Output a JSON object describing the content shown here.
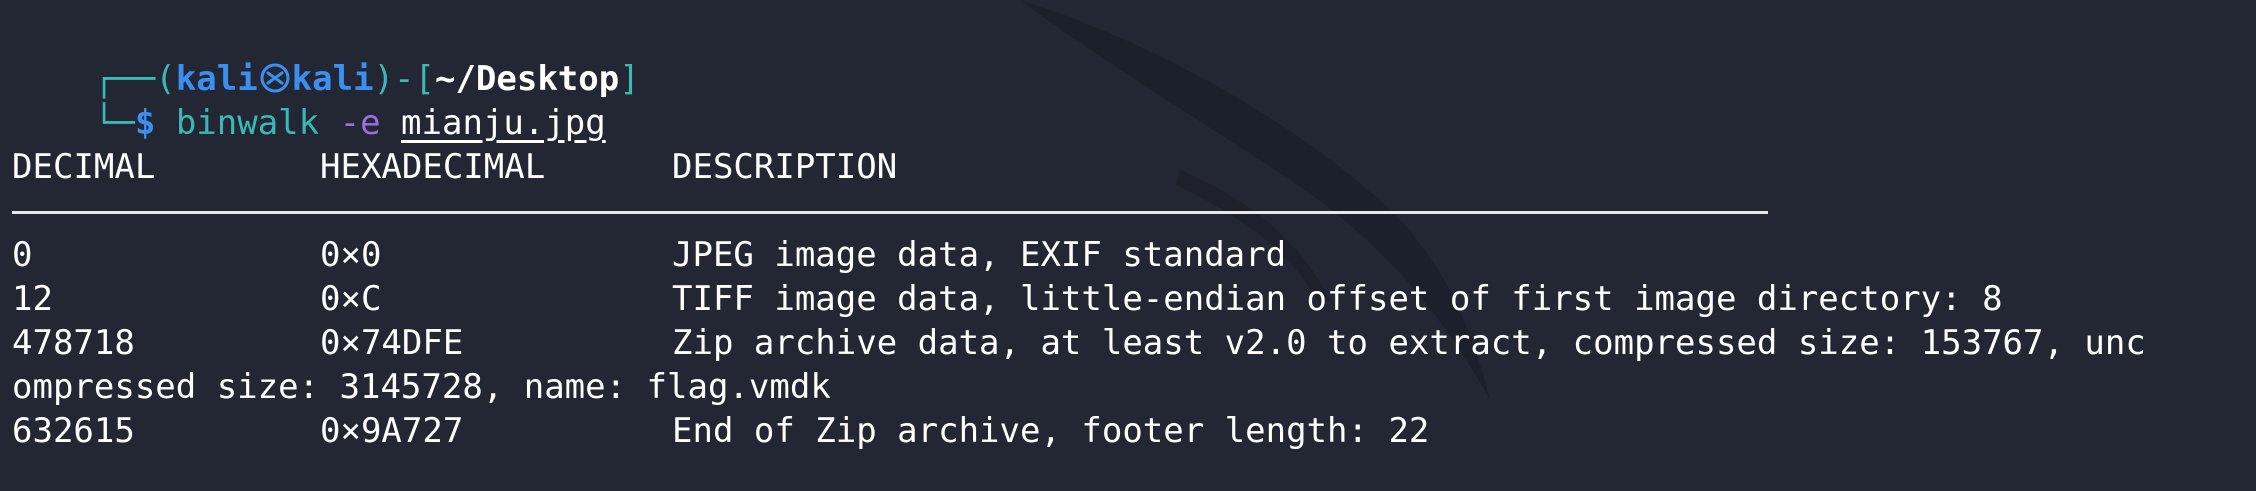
{
  "prompt": {
    "corner_top": "┌──(",
    "user": "kali",
    "host": "kali",
    "bracket_mid": ")-[",
    "cwd": "~/Desktop",
    "bracket_end": "]",
    "corner_bottom": "└─",
    "symbol": "$",
    "command": "binwalk",
    "flag": "-e",
    "argument": "mianju.jpg"
  },
  "output": {
    "headers": [
      "DECIMAL",
      "HEXADECIMAL",
      "DESCRIPTION"
    ],
    "rows": [
      {
        "decimal": "0",
        "hex": "0×0",
        "description": "JPEG image data, EXIF standard"
      },
      {
        "decimal": "12",
        "hex": "0×C",
        "description": "TIFF image data, little-endian offset of first image directory: 8"
      },
      {
        "decimal": "478718",
        "hex": "0×74DFE",
        "description": "Zip archive data, at least v2.0 to extract, compressed size: 153767, unc"
      },
      {
        "decimal": "",
        "hex": "",
        "description": "ompressed size: 3145728, name: flag.vmdk"
      },
      {
        "decimal": "632615",
        "hex": "0×9A727",
        "description": "End of Zip archive, footer length: 22"
      }
    ]
  },
  "colors": {
    "background": "#232733",
    "prompt_blue": "#3a8ff0",
    "prompt_teal": "#39b8b5",
    "flag_purple": "#9a6fe0",
    "text": "#ffffff"
  },
  "icons": [
    "kali-dragon-icon"
  ]
}
